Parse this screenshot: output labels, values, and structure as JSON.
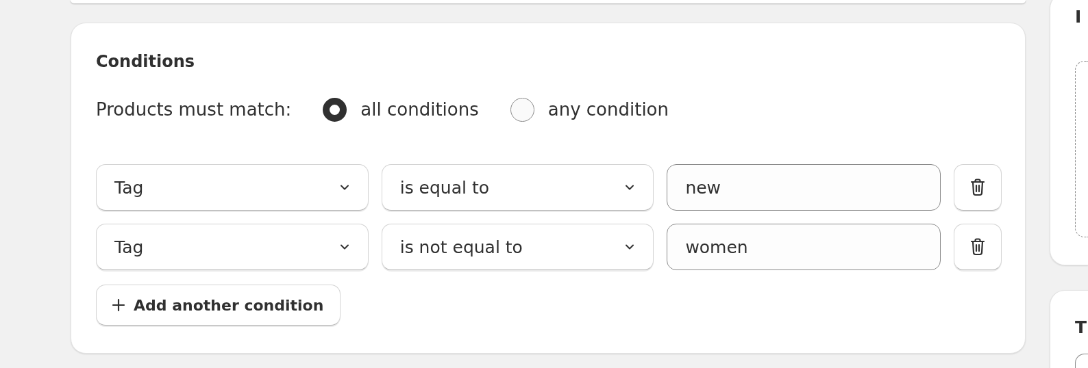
{
  "conditions": {
    "title": "Conditions",
    "match_label": "Products must match:",
    "match_options": [
      {
        "label": "all conditions",
        "selected": true
      },
      {
        "label": "any condition",
        "selected": false
      }
    ],
    "rows": [
      {
        "field": "Tag",
        "operator": "is equal to",
        "value": "new"
      },
      {
        "field": "Tag",
        "operator": "is not equal to",
        "value": "women"
      }
    ],
    "add_button": "Add another condition"
  },
  "side_cards": [
    {
      "title": "I",
      "kind": "dropzone"
    },
    {
      "title": "T",
      "kind": "plain"
    }
  ]
}
